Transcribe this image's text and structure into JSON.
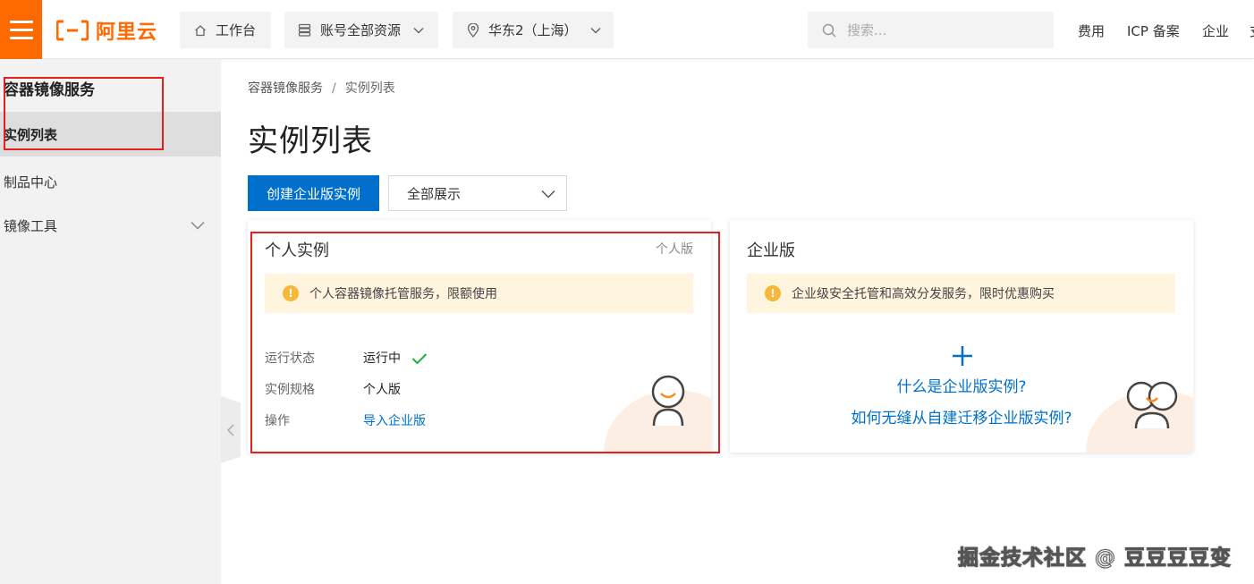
{
  "topbar": {
    "logo_text": "阿里云",
    "workbench_label": "工作台",
    "resources_label": "账号全部资源",
    "region_label": "华东2（上海）",
    "search_placeholder": "搜索...",
    "links": [
      "费用",
      "ICP 备案",
      "企业",
      "支"
    ]
  },
  "sidebar": {
    "title": "容器镜像服务",
    "items": [
      {
        "label": "实例列表"
      },
      {
        "label": "制品中心"
      },
      {
        "label": "镜像工具"
      }
    ]
  },
  "breadcrumb": {
    "root": "容器镜像服务",
    "separator": "/",
    "current": "实例列表"
  },
  "page": {
    "title": "实例列表",
    "create_button": "创建企业版实例",
    "filter_value": "全部展示"
  },
  "personal_card": {
    "title": "个人实例",
    "badge": "个人版",
    "notice": "个人容器镜像托管服务，限额使用",
    "status_label": "运行状态",
    "status_value": "运行中",
    "spec_label": "实例规格",
    "spec_value": "个人版",
    "action_label": "操作",
    "action_link": "导入企业版"
  },
  "enterprise_card": {
    "title": "企业版",
    "notice": "企业级安全托管和高效分发服务，限时优惠购买",
    "link_what": "什么是企业版实例?",
    "link_migrate": "如何无缝从自建迁移企业版实例?"
  },
  "watermark": "掘金技术社区 @ 豆豆豆豆变",
  "colors": {
    "brand_orange": "#ff6a00",
    "primary_blue": "#0070cc",
    "highlight_red": "#e32020",
    "success_green": "#1db040",
    "warning_yellow": "#f6b83a"
  }
}
